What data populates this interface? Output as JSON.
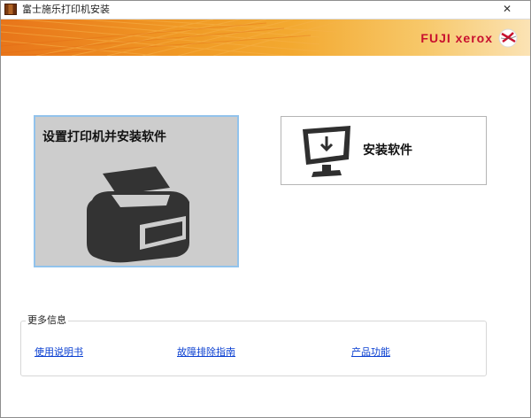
{
  "window": {
    "title": "富士施乐打印机安装",
    "close_glyph": "✕"
  },
  "banner": {
    "brand": "FUJI xerox",
    "colors": {
      "orange": "#f09a25",
      "brand_red": "#c8102e"
    }
  },
  "tiles": {
    "setup": {
      "label": "设置打印机并安装软件",
      "icon": "printer-icon"
    },
    "install": {
      "label": "安装软件",
      "icon": "monitor-download-icon"
    }
  },
  "more_info": {
    "title": "更多信息",
    "links": [
      {
        "label": "使用说明书"
      },
      {
        "label": "故障排除指南"
      },
      {
        "label": "产品功能"
      }
    ]
  }
}
